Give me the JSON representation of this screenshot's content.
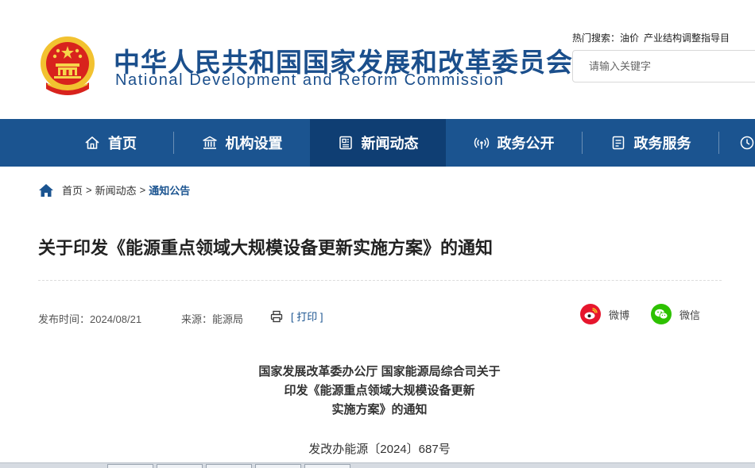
{
  "header": {
    "title_cn": "中华人民共和国国家发展和改革委员会",
    "title_en": "National Development and Reform Commission",
    "hot_search_label": "热门搜索：",
    "hot_search_items": [
      "油价",
      "产业结构调整指导目"
    ],
    "search_placeholder": "请输入关键字"
  },
  "nav": {
    "items": [
      {
        "label": "首页",
        "icon": "home-icon"
      },
      {
        "label": "机构设置",
        "icon": "building-icon"
      },
      {
        "label": "新闻动态",
        "icon": "news-icon",
        "active": true
      },
      {
        "label": "政务公开",
        "icon": "broadcast-icon"
      },
      {
        "label": "政务服务",
        "icon": "document-icon"
      }
    ]
  },
  "breadcrumb": {
    "items": [
      "首页",
      "新闻动态",
      "通知公告"
    ],
    "separator": ">"
  },
  "article": {
    "title": "关于印发《能源重点领域大规模设备更新实施方案》的通知",
    "publish_time": "发布时间：2024/08/21",
    "source": "来源：能源局",
    "print_label": "[ 打印 ]",
    "share_weibo": "微博",
    "share_wechat": "微信",
    "doc_heading_lines": [
      "国家发展改革委办公厅 国家能源局综合司关于",
      "印发《能源重点领域大规模设备更新",
      "实施方案》的通知"
    ],
    "doc_number": "发改办能源〔2024〕687号"
  },
  "colors": {
    "brand_blue": "#1b5490",
    "nav_active": "#0f3e73",
    "weibo_red": "#e6162d",
    "wechat_green": "#2dc100"
  }
}
